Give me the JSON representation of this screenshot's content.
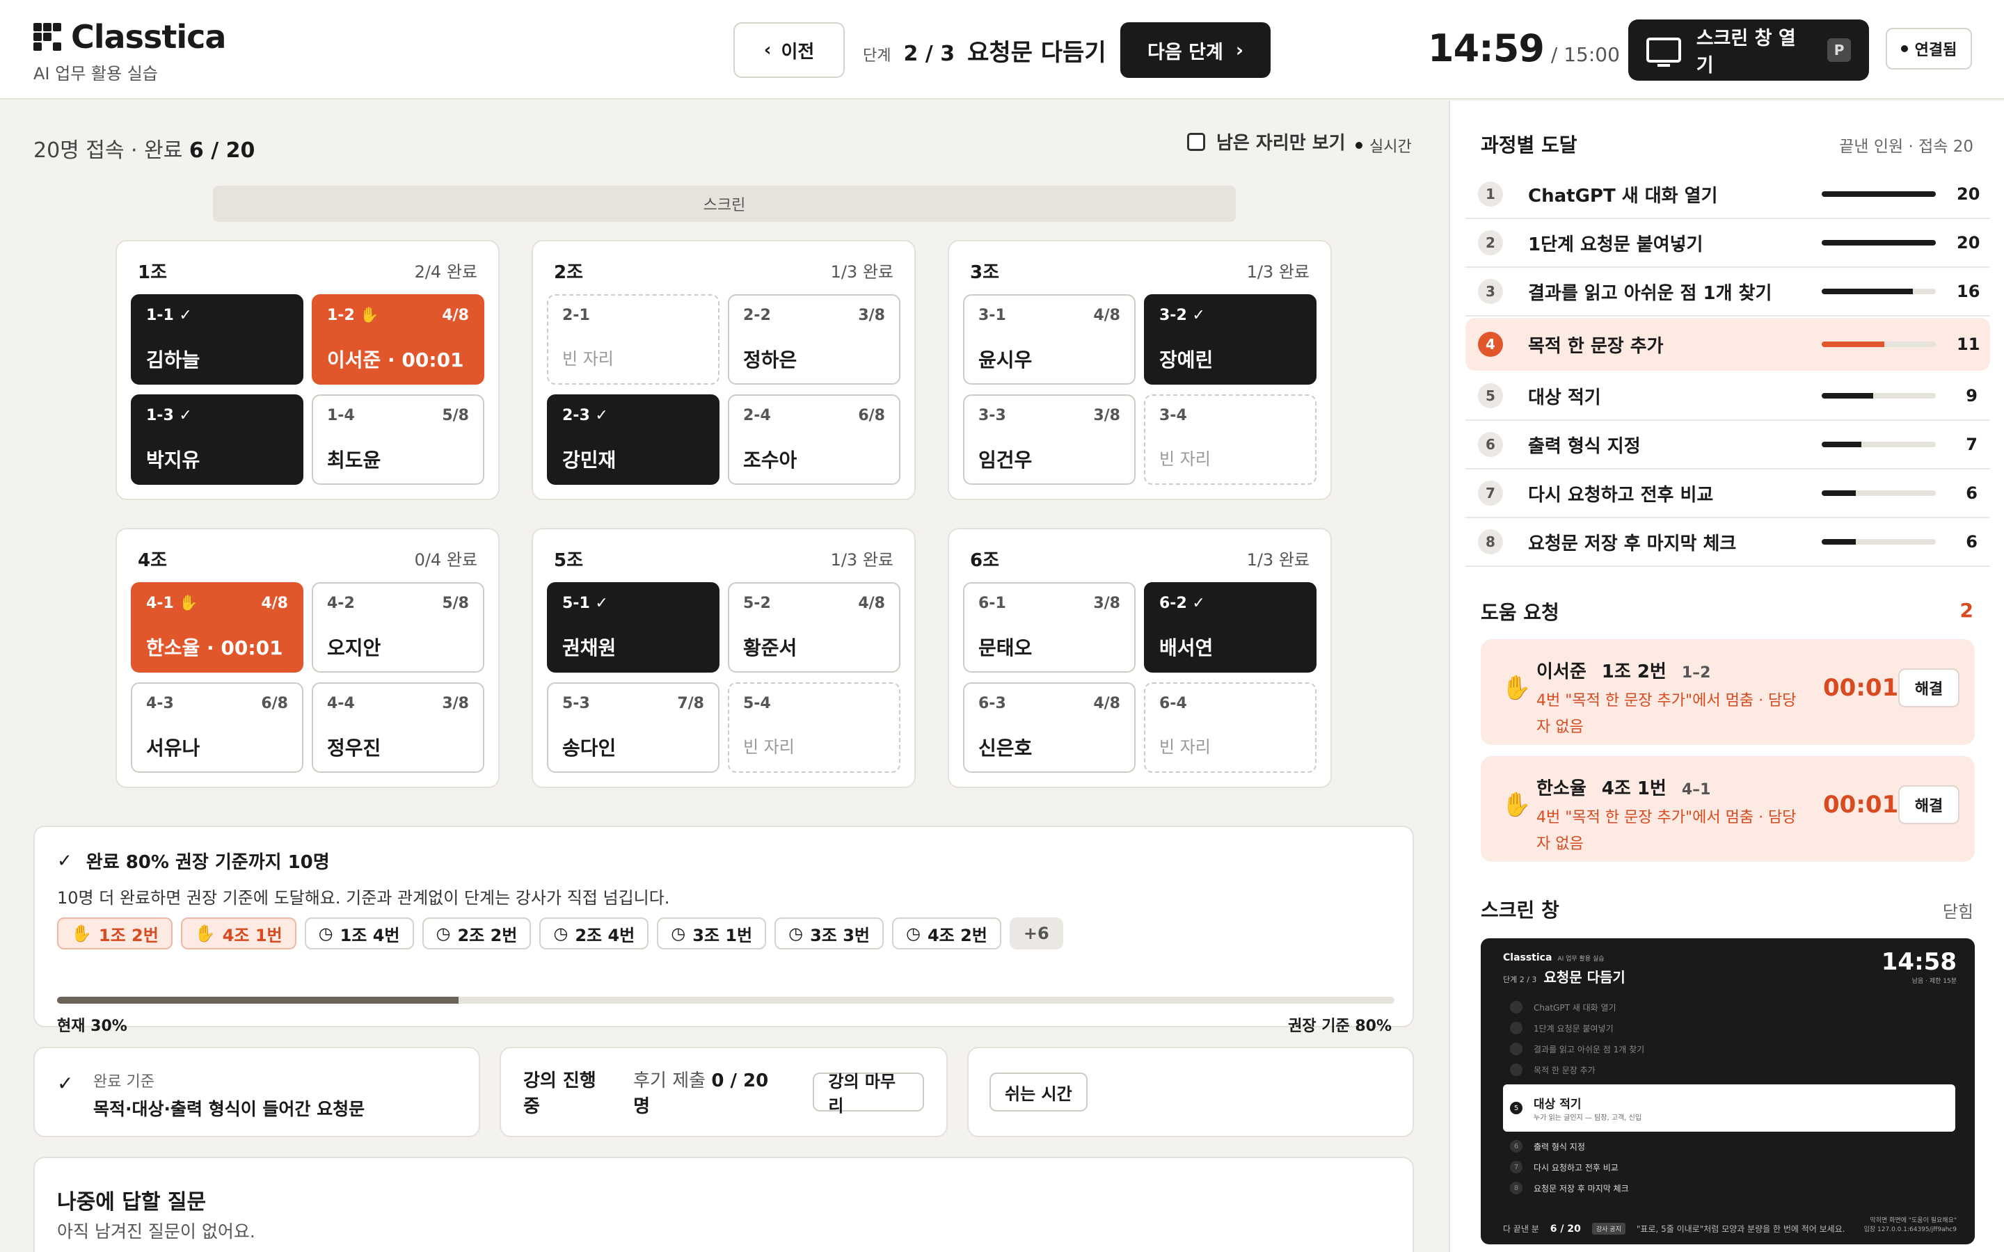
{
  "header": {
    "brand": "Classtica",
    "subtitle": "AI 업무 활용 실습",
    "prev_label": "이전",
    "step_label": "단계",
    "step_num": "2 / 3",
    "step_title": "요청문 다듬기",
    "next_label": "다음 단계",
    "clock": "14:59",
    "clock_total": "/ 15:00",
    "screen_btn": "스크린 창 열기",
    "screen_key": "P",
    "connection": "연결됨"
  },
  "main": {
    "status_prefix": "20명 접속 · 완료",
    "status_value": "6 / 20",
    "only_empty": "남은 자리만 보기",
    "live": "실시간",
    "screen_label": "스크린"
  },
  "teams": [
    {
      "name": "1조",
      "done": "2/4 완료",
      "seats": [
        {
          "id": "1-1 ✓",
          "prog": "",
          "name": "김하늘",
          "state": "done"
        },
        {
          "id": "1-2 ✋",
          "prog": "4/8",
          "name": "이서준 · 00:01",
          "state": "help"
        },
        {
          "id": "1-3 ✓",
          "prog": "",
          "name": "박지유",
          "state": "done"
        },
        {
          "id": "1-4",
          "prog": "5/8",
          "name": "최도윤",
          "state": "normal"
        }
      ]
    },
    {
      "name": "2조",
      "done": "1/3 완료",
      "seats": [
        {
          "id": "2-1",
          "prog": "",
          "name": "빈 자리",
          "state": "empty"
        },
        {
          "id": "2-2",
          "prog": "3/8",
          "name": "정하은",
          "state": "normal"
        },
        {
          "id": "2-3 ✓",
          "prog": "",
          "name": "강민재",
          "state": "done"
        },
        {
          "id": "2-4",
          "prog": "6/8",
          "name": "조수아",
          "state": "normal"
        }
      ]
    },
    {
      "name": "3조",
      "done": "1/3 완료",
      "seats": [
        {
          "id": "3-1",
          "prog": "4/8",
          "name": "윤시우",
          "state": "normal"
        },
        {
          "id": "3-2 ✓",
          "prog": "",
          "name": "장예린",
          "state": "done"
        },
        {
          "id": "3-3",
          "prog": "3/8",
          "name": "임건우",
          "state": "normal"
        },
        {
          "id": "3-4",
          "prog": "",
          "name": "빈 자리",
          "state": "empty"
        }
      ]
    },
    {
      "name": "4조",
      "done": "0/4 완료",
      "seats": [
        {
          "id": "4-1 ✋",
          "prog": "4/8",
          "name": "한소율 · 00:01",
          "state": "help"
        },
        {
          "id": "4-2",
          "prog": "5/8",
          "name": "오지안",
          "state": "normal"
        },
        {
          "id": "4-3",
          "prog": "6/8",
          "name": "서유나",
          "state": "normal"
        },
        {
          "id": "4-4",
          "prog": "3/8",
          "name": "정우진",
          "state": "normal"
        }
      ]
    },
    {
      "name": "5조",
      "done": "1/3 완료",
      "seats": [
        {
          "id": "5-1 ✓",
          "prog": "",
          "name": "권채원",
          "state": "done"
        },
        {
          "id": "5-2",
          "prog": "4/8",
          "name": "황준서",
          "state": "normal"
        },
        {
          "id": "5-3",
          "prog": "7/8",
          "name": "송다인",
          "state": "normal"
        },
        {
          "id": "5-4",
          "prog": "",
          "name": "빈 자리",
          "state": "empty"
        }
      ]
    },
    {
      "name": "6조",
      "done": "1/3 완료",
      "seats": [
        {
          "id": "6-1",
          "prog": "3/8",
          "name": "문태오",
          "state": "normal"
        },
        {
          "id": "6-2 ✓",
          "prog": "",
          "name": "배서연",
          "state": "done"
        },
        {
          "id": "6-3",
          "prog": "4/8",
          "name": "신은호",
          "state": "normal"
        },
        {
          "id": "6-4",
          "prog": "",
          "name": "빈 자리",
          "state": "empty"
        }
      ]
    }
  ],
  "recommend": {
    "title": "완료 80% 권장 기준까지 10명",
    "desc": "10명 더 완료하면 권장 기준에 도달해요. 기준과 관계없이 단계는 강사가 직접 넘깁니다.",
    "chips": [
      {
        "icon": "✋",
        "label": "1조 2번",
        "kind": "help"
      },
      {
        "icon": "✋",
        "label": "4조 1번",
        "kind": "help"
      },
      {
        "icon": "◷",
        "label": "1조 4번",
        "kind": "normal"
      },
      {
        "icon": "◷",
        "label": "2조 2번",
        "kind": "normal"
      },
      {
        "icon": "◷",
        "label": "2조 4번",
        "kind": "normal"
      },
      {
        "icon": "◷",
        "label": "3조 1번",
        "kind": "normal"
      },
      {
        "icon": "◷",
        "label": "3조 3번",
        "kind": "normal"
      },
      {
        "icon": "◷",
        "label": "4조 2번",
        "kind": "normal"
      },
      {
        "icon": "",
        "label": "+6",
        "kind": "more"
      }
    ],
    "progress": 0.3,
    "now_label": "현재 30%",
    "goal_label": "권장 기준 80%"
  },
  "criteria": {
    "label": "완료 기준",
    "text": "목적·대상·출력 형식이 들어간 요청문"
  },
  "lecture": {
    "title": "강의 진행 중",
    "sub_prefix": "후기 제출",
    "sub_value": "0 / 20명",
    "finish_btn": "강의 마무리"
  },
  "break_btn": "쉬는 시간",
  "questions": {
    "title": "나중에 답할 질문",
    "empty": "아직 남겨진 질문이 없어요."
  },
  "sidebar": {
    "steps_title": "과정별 도달",
    "steps_meta": "끝낸 인원 · 접속 20",
    "steps": [
      {
        "idx": "1",
        "name": "ChatGPT 새 대화 열기",
        "count": "20",
        "ratio": 1.0
      },
      {
        "idx": "2",
        "name": "1단계 요청문 붙여넣기",
        "count": "20",
        "ratio": 1.0
      },
      {
        "idx": "3",
        "name": "결과를 읽고 아쉬운 점 1개 찾기",
        "count": "16",
        "ratio": 0.8
      },
      {
        "idx": "4",
        "name": "목적 한 문장 추가",
        "count": "11",
        "ratio": 0.55,
        "active": true
      },
      {
        "idx": "5",
        "name": "대상 적기",
        "count": "9",
        "ratio": 0.45
      },
      {
        "idx": "6",
        "name": "출력 형식 지정",
        "count": "7",
        "ratio": 0.35
      },
      {
        "idx": "7",
        "name": "다시 요청하고 전후 비교",
        "count": "6",
        "ratio": 0.3
      },
      {
        "idx": "8",
        "name": "요청문 저장 후 마지막 체크",
        "count": "6",
        "ratio": 0.3
      }
    ],
    "help_title": "도움 요청",
    "help_count": "2",
    "help": [
      {
        "name": "이서준",
        "team": "1조 2번",
        "seat": "1–2",
        "msg": "4번 \"목적 한 문장 추가\"에서 멈춤 · 담당자 없음",
        "time": "00:01",
        "btn": "해결"
      },
      {
        "name": "한소율",
        "team": "4조 1번",
        "seat": "4–1",
        "msg": "4번 \"목적 한 문장 추가\"에서 멈춤 · 담당자 없음",
        "time": "00:01",
        "btn": "해결"
      }
    ],
    "screen_title": "스크린 창",
    "close_label": "닫힘",
    "preview": {
      "brand": "Classtica",
      "brand_sub": "AI 업무 활용 실습",
      "step_small": "단계 2 / 3",
      "step_title": "요청문 다듬기",
      "time": "14:58",
      "time_sub": "남음 · 제한 15분",
      "items": [
        {
          "idx": "",
          "text": "ChatGPT 새 대화 열기",
          "kind": "past"
        },
        {
          "idx": "",
          "text": "1단계 요청문 붙여넣기",
          "kind": "past"
        },
        {
          "idx": "",
          "text": "결과를 읽고 아쉬운 점 1개 찾기",
          "kind": "past"
        },
        {
          "idx": "",
          "text": "목적 한 문장 추가",
          "kind": "past"
        },
        {
          "idx": "5",
          "text": "대상 적기",
          "sub": "누가 읽는 글인지 — 팀장, 고객, 신입",
          "kind": "cur"
        },
        {
          "idx": "6",
          "text": "출력 형식 지정",
          "kind": "next"
        },
        {
          "idx": "7",
          "text": "다시 요청하고 전후 비교",
          "kind": "next"
        },
        {
          "idx": "8",
          "text": "요청문 저장 후 마지막 체크",
          "kind": "next"
        }
      ],
      "foot_label": "다 끝낸 분",
      "foot_value": "6 / 20",
      "foot_tag": "강사 공지",
      "foot_msg": "\"표로, 5줄 이내로\"처럼 모양과 분량을 한 번에 적어 보세요.",
      "url_line1": "막히면 화면에 \"도움이 필요해요\"",
      "url_line2": "입장 127.0.0.1:64395/jff9ahc9"
    }
  },
  "colors": {
    "accent": "#e2562c",
    "dark": "#1a1a1a",
    "bg": "#f4f2ee"
  }
}
